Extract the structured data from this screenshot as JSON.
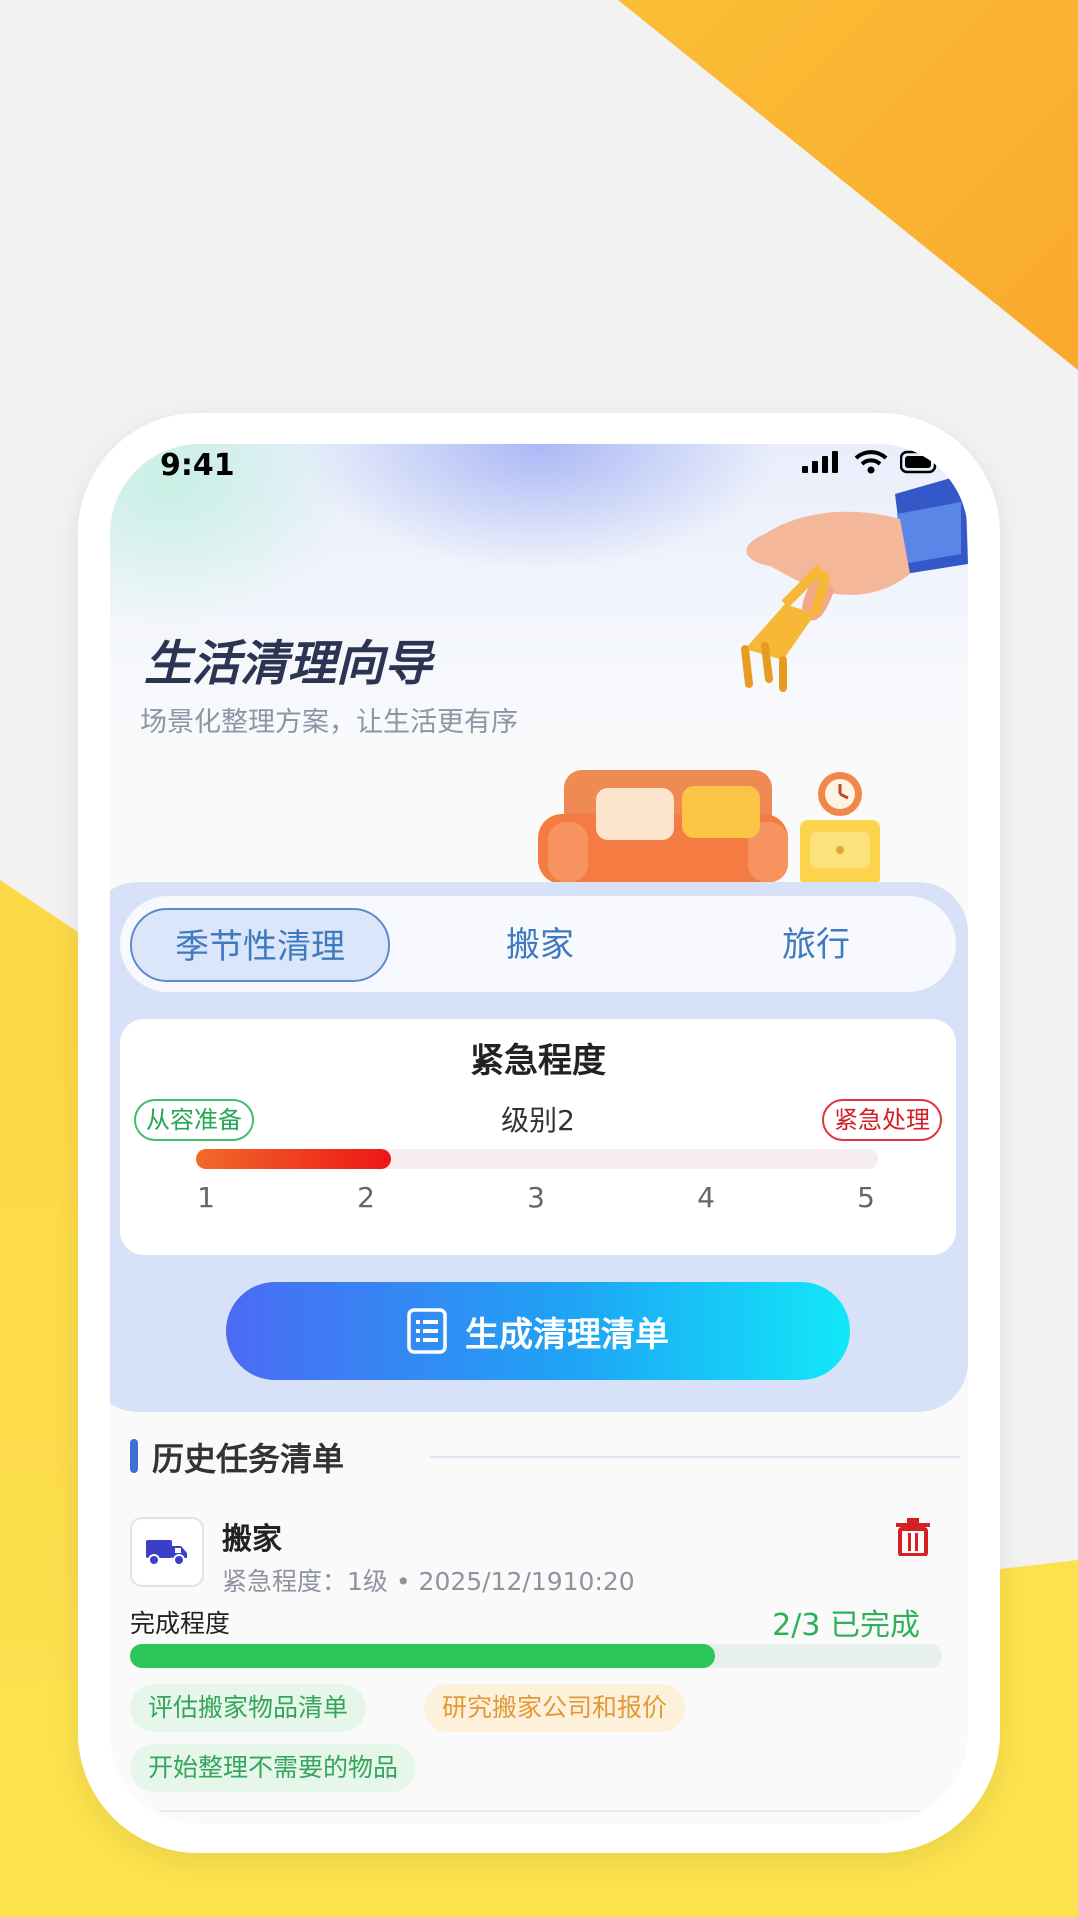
{
  "status_bar": {
    "time": "9:41"
  },
  "hero": {
    "title": "生活清理向导",
    "subtitle": "场景化整理方案，让生活更有序"
  },
  "tabs": [
    {
      "label": "季节性清理",
      "active": true
    },
    {
      "label": "搬家",
      "active": false
    },
    {
      "label": "旅行",
      "active": false
    }
  ],
  "urgency": {
    "title": "紧急程度",
    "level_text": "级别2",
    "left_label": "从容准备",
    "right_label": "紧急处理",
    "value": 2,
    "max": 5,
    "ticks": [
      "1",
      "2",
      "3",
      "4",
      "5"
    ]
  },
  "generate_button": {
    "label": "生成清理清单",
    "icon": "list-icon"
  },
  "history": {
    "title": "历史任务清单",
    "tasks": [
      {
        "name": "搬家",
        "icon": "truck-icon",
        "meta": "紧急程度：1级 • 2025/12/1910:20",
        "progress_label": "完成程度",
        "progress_text": "2/3 已完成",
        "progress_fraction": 0.72,
        "items": [
          {
            "label": "评估搬家物品清单",
            "color": "green"
          },
          {
            "label": "研究搬家公司和报价",
            "color": "orange"
          },
          {
            "label": "开始整理不需要的物品",
            "color": "green"
          }
        ]
      }
    ]
  },
  "colors": {
    "accent": "#3d6fd9",
    "success": "#2cc75a",
    "danger": "#d21e27",
    "panel": "#d7e1f7"
  }
}
